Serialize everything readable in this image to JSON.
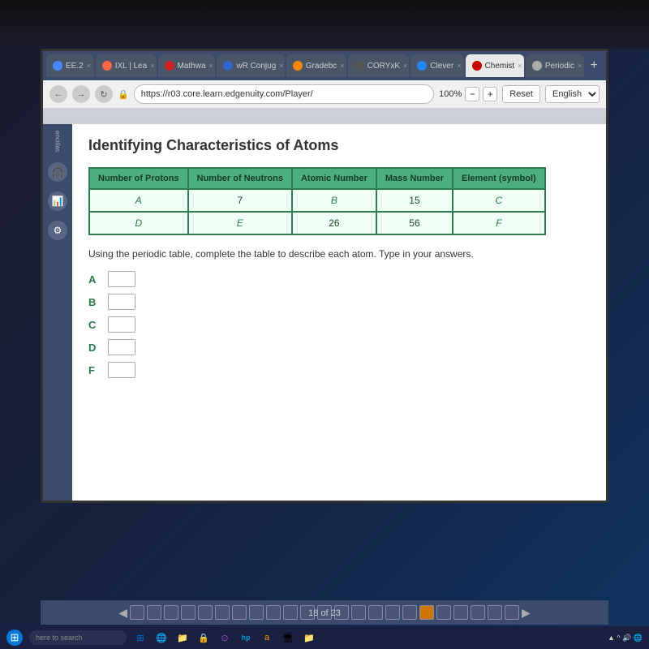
{
  "browser": {
    "address": "https://r03.core.learn.edgenuity.com/Player/",
    "zoom": "100%",
    "reset_label": "Reset",
    "language": "English",
    "tabs": [
      {
        "id": "tab1",
        "label": "EE.2",
        "icon_color": "#4488ff",
        "active": false
      },
      {
        "id": "tab2",
        "label": "IXL | Lea",
        "icon_color": "#ff6644",
        "active": false
      },
      {
        "id": "tab3",
        "label": "Mathwa",
        "icon_color": "#cc2222",
        "active": false
      },
      {
        "id": "tab4",
        "label": "wR Conjug",
        "icon_color": "#3366cc",
        "active": false
      },
      {
        "id": "tab5",
        "label": "Gradebc",
        "icon_color": "#ff8800",
        "active": false
      },
      {
        "id": "tab6",
        "label": "CORYxK",
        "icon_color": "#555",
        "active": false
      },
      {
        "id": "tab7",
        "label": "Clever",
        "icon_color": "#2288ff",
        "active": false
      },
      {
        "id": "tab8",
        "label": "Chemist",
        "icon_color": "#cc0000",
        "active": true
      },
      {
        "id": "tab9",
        "label": "Periodic",
        "icon_color": "#aaaaaa",
        "active": false
      }
    ]
  },
  "sidebar": {
    "label": "encillas",
    "items": [
      "🎧",
      "📊",
      "⚙"
    ]
  },
  "page": {
    "title": "Identifying Characteristics of Atoms",
    "table": {
      "headers": [
        "Number of Protons",
        "Number of Neutrons",
        "Atomic Number",
        "Mass Number",
        "Element (symbol)"
      ],
      "rows": [
        {
          "col1": "A",
          "col2": "7",
          "col3": "B",
          "col4": "15",
          "col5": "C"
        },
        {
          "col1": "D",
          "col2": "E",
          "col3": "26",
          "col4": "56",
          "col5": "F"
        }
      ]
    },
    "instructions": "Using the periodic table, complete the table to describe each atom. Type in your answers.",
    "answers": [
      {
        "label": "A"
      },
      {
        "label": "B"
      },
      {
        "label": "C"
      },
      {
        "label": "D"
      },
      {
        "label": "F"
      }
    ]
  },
  "progress": {
    "current": 18,
    "total": 23,
    "label": "18 of 23",
    "dots": 23,
    "active_dot": 18
  },
  "taskbar": {
    "search_placeholder": "here to search",
    "icons": [
      "⊞",
      "⌕",
      "🗔",
      "📁",
      "🔒",
      "⊙",
      "hp",
      "a",
      "🖥",
      "📁"
    ]
  }
}
